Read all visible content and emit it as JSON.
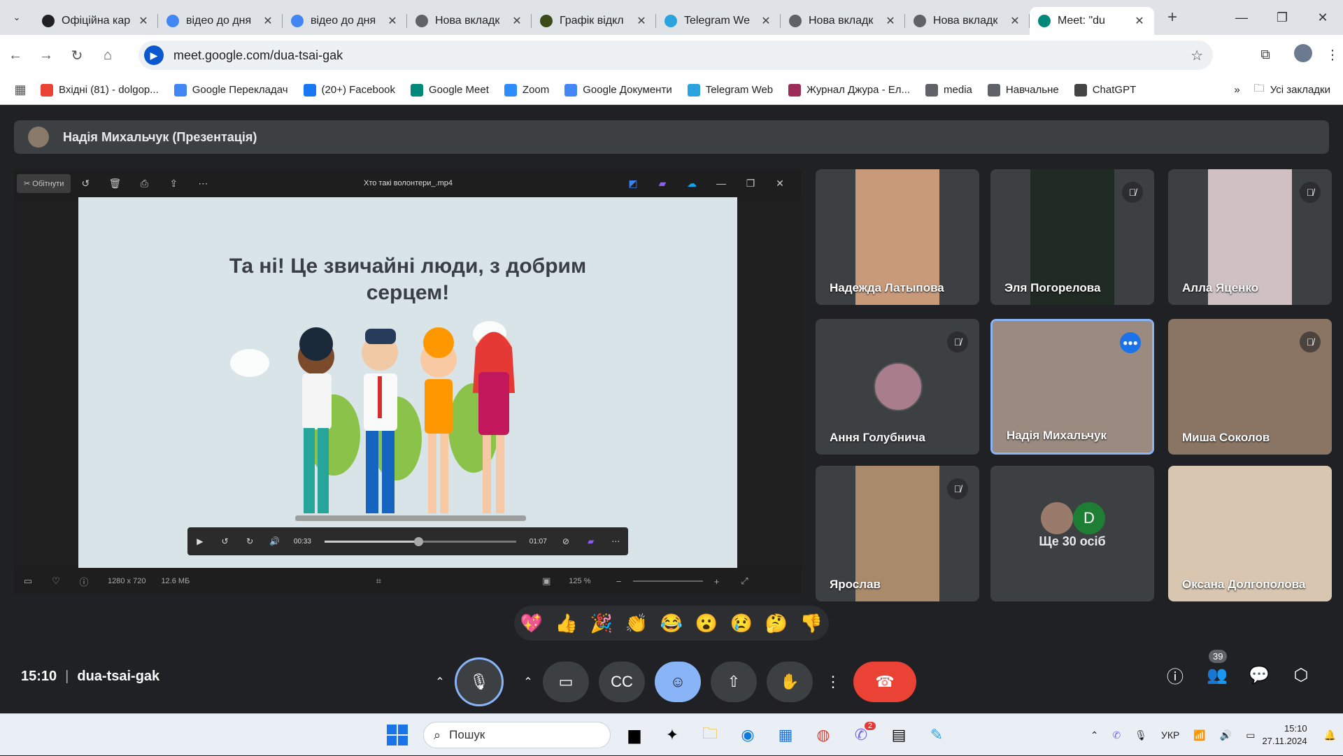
{
  "browser": {
    "tabs": [
      {
        "title": "Офіційна кар",
        "icon": "shield-icon",
        "color": "#202124"
      },
      {
        "title": "відео до дня",
        "icon": "google-icon",
        "color": "#4285f4"
      },
      {
        "title": "відео до дня",
        "icon": "google-icon",
        "color": "#4285f4"
      },
      {
        "title": "Нова вкладк",
        "icon": "chrome-icon",
        "color": "#5f6368"
      },
      {
        "title": "Графік відкл",
        "icon": "power-icon",
        "color": "#3b4b1a"
      },
      {
        "title": "Telegram We",
        "icon": "telegram-icon",
        "color": "#2aa3df"
      },
      {
        "title": "Нова вкладк",
        "icon": "chrome-icon",
        "color": "#5f6368"
      },
      {
        "title": "Нова вкладк",
        "icon": "chrome-icon",
        "color": "#5f6368"
      },
      {
        "title": "Meet: \"du",
        "icon": "meet-icon",
        "color": "#00897b",
        "active": true
      }
    ],
    "url": "meet.google.com/dua-tsai-gak",
    "bookmarks": [
      {
        "label": "Вхідні (81) - dolgop...",
        "icon": "gmail-icon",
        "color": "#ea4335"
      },
      {
        "label": "Google Перекладач",
        "icon": "translate-icon",
        "color": "#4285f4"
      },
      {
        "label": "(20+) Facebook",
        "icon": "facebook-icon",
        "color": "#1877f2"
      },
      {
        "label": "Google Meet",
        "icon": "meet-icon",
        "color": "#00897b"
      },
      {
        "label": "Zoom",
        "icon": "zoom-icon",
        "color": "#2d8cff"
      },
      {
        "label": "Google Документи",
        "icon": "docs-icon",
        "color": "#4285f4"
      },
      {
        "label": "Telegram Web",
        "icon": "telegram-icon",
        "color": "#2aa3df"
      },
      {
        "label": "Журнал Джура - Ел...",
        "icon": "journal-icon",
        "color": "#9c2c5a"
      },
      {
        "label": "media",
        "icon": "folder-icon",
        "color": "#5f6368"
      },
      {
        "label": "Навчальне",
        "icon": "folder-icon",
        "color": "#5f6368"
      },
      {
        "label": "ChatGPT",
        "icon": "chatgpt-icon",
        "color": "#444"
      }
    ],
    "all_bookmarks": "Усі закладки"
  },
  "meet": {
    "presenter": "Надія Михальчук (Презентація)",
    "player": {
      "trim": "Обітнути",
      "filename": "Хто такі волонтери_.mp4",
      "slide_text": "Та ні! Це звичайні люди, з добрим серцем!",
      "current_time": "00:33",
      "duration": "01:07",
      "progress": 0.49,
      "resolution": "1280 x 720",
      "size": "12.6 МБ",
      "zoom": "125 %"
    },
    "participants": [
      {
        "name": "Надежда Латыпова",
        "muted": false
      },
      {
        "name": "Эля Погорелова",
        "muted": true
      },
      {
        "name": "Алла Яценко",
        "muted": true
      },
      {
        "name": "Ання Голубнича",
        "muted": true
      },
      {
        "name": "Надія Михальчук",
        "muted": false,
        "speaking": true
      },
      {
        "name": "Миша Соколов",
        "muted": true
      },
      {
        "name": "Ярослав",
        "muted": true
      },
      {
        "name": "Ще 30 осіб",
        "muted": false
      },
      {
        "name": "Оксана Долгополова",
        "muted": false
      }
    ],
    "others_initial": "D",
    "reactions": [
      "💖",
      "👍",
      "🎉",
      "👏",
      "😂",
      "😮",
      "😢",
      "🤔",
      "👎"
    ],
    "time": "15:10",
    "code": "dua-tsai-gak",
    "people_count": "39"
  },
  "taskbar": {
    "search_placeholder": "Пошук",
    "lang": "УКР",
    "time": "15:10",
    "date": "27.11.2024",
    "viber_badge": "2"
  }
}
